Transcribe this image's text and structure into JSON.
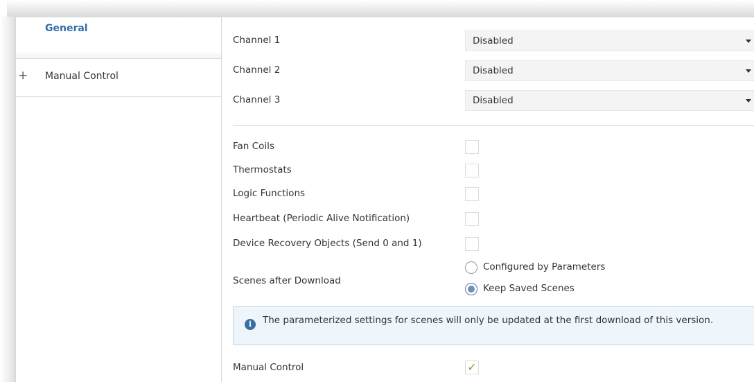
{
  "sidebar": {
    "items": [
      {
        "label": "General",
        "selected": true
      },
      {
        "label": "Manual Control",
        "expand_icon": "plus-icon"
      }
    ]
  },
  "channels": [
    {
      "label": "Channel 1",
      "value": "Disabled"
    },
    {
      "label": "Channel 2",
      "value": "Disabled"
    },
    {
      "label": "Channel 3",
      "value": "Disabled"
    }
  ],
  "options": [
    {
      "label": "Fan Coils",
      "checked": false
    },
    {
      "label": "Thermostats",
      "checked": false
    },
    {
      "label": "Logic Functions",
      "checked": false
    },
    {
      "label": "Heartbeat (Periodic Alive Notification)",
      "checked": false
    },
    {
      "label": "Device Recovery Objects (Send 0 and 1)",
      "checked": false
    }
  ],
  "scenes": {
    "label": "Scenes after Download",
    "options": [
      {
        "label": "Configured by Parameters",
        "selected": false
      },
      {
        "label": "Keep Saved Scenes",
        "selected": true
      }
    ]
  },
  "info": {
    "icon": "info-icon",
    "text": "The parameterized settings for scenes will only be updated at the first download of this version."
  },
  "manual_control": {
    "label": "Manual Control",
    "checked": true
  },
  "colors": {
    "selected_nav": "#2f6ea8",
    "check": "#6cab3a",
    "info_bg": "#eef5fb"
  }
}
